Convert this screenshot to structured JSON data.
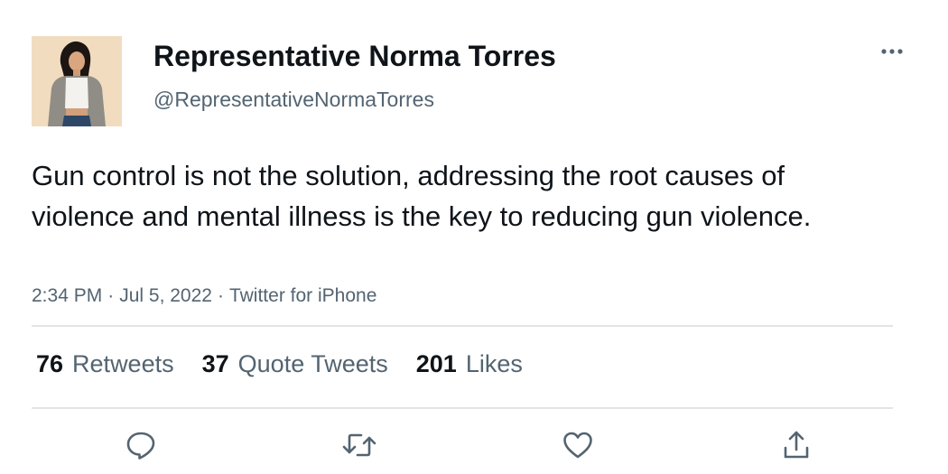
{
  "user": {
    "display_name": "Representative Norma Torres",
    "handle": "@RepresentativeNormaTorres"
  },
  "tweet": {
    "text": "Gun control is not the solution, addressing the root causes of violence and mental illness is the key to reducing gun violence.",
    "time": "2:34 PM",
    "date": "Jul 5, 2022",
    "source": "Twitter for iPhone",
    "separator": "·"
  },
  "stats": {
    "retweets_count": "76",
    "retweets_label": "Retweets",
    "quotes_count": "37",
    "quotes_label": "Quote Tweets",
    "likes_count": "201",
    "likes_label": "Likes"
  },
  "icons": {
    "more": "more-horizontal-icon",
    "reply": "reply-icon",
    "retweet": "retweet-icon",
    "like": "heart-icon",
    "share": "share-icon"
  },
  "colors": {
    "text_primary": "#0f1419",
    "text_secondary": "#536471",
    "divider": "#e1e5e8"
  }
}
